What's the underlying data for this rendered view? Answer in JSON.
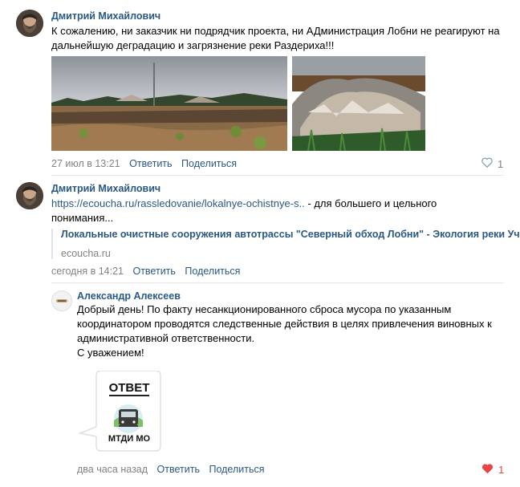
{
  "comments": [
    {
      "author": "Дмитрий Михайлович",
      "text": "К сожалению, ни заказчик ни подрядчик проекта, ни АДминистрация Лобни не реагируют на дальнейшую деградацию и загрязнение реки Раздериха!!!",
      "time": "27 июл в 13:21",
      "reply_label": "Ответить",
      "share_label": "Поделиться",
      "likes": "1"
    },
    {
      "author": "Дмитрий Михайлович",
      "link_text": "https://ecoucha.ru/rassledovanie/lokalnye-ochistnye-s..",
      "text_after": " - для большего и цельного понимания...",
      "snippet_title": "Локальные очистные сооружения автотрассы \"Северный обход Лобни\" - Экология реки Уча",
      "snippet_domain": "ecoucha.ru",
      "time": "сегодня в 14:21",
      "reply_label": "Ответить",
      "share_label": "Поделиться"
    },
    {
      "author": "Александр Алексеев",
      "text_lines": [
        "Добрый день! По факту несанкционированного сброса мусора по указанным координатором проводятся следственные действия в целях привлечения виновных к административной ответственности.",
        "С уважением!"
      ],
      "sticker_title": "ОТВЕТ",
      "sticker_caption": "МТДИ МО",
      "time": "два часа назад",
      "reply_label": "Ответить",
      "share_label": "Поделиться",
      "likes": "1"
    }
  ],
  "colors": {
    "link": "#2a5885",
    "meta": "#828282",
    "like_active": "#e64646"
  },
  "icons": [
    "heart-outline-icon",
    "heart-filled-icon"
  ]
}
